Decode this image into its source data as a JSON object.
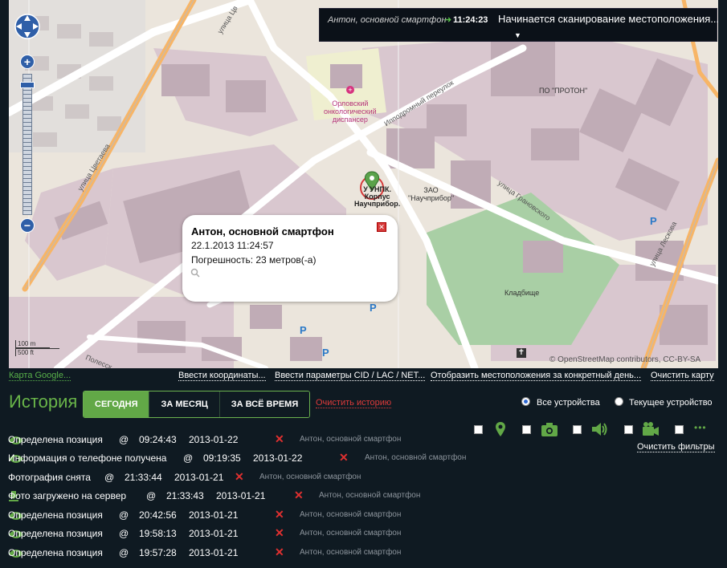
{
  "map": {
    "streets": {
      "tsvetaeva": "улица Цветаева",
      "tsv_top": "улица Цв",
      "ippodromny": "Ипподромный переулок",
      "granovskogo": "улица Грановского",
      "leskova": "улица Лескова",
      "polesskaya": "Полесск"
    },
    "pois": {
      "oncology": [
        "Орловский",
        "онкологический",
        "диспансер"
      ],
      "proton": "ПО \"ПРОТОН\"",
      "nauchpribor": [
        "ЗАО",
        "\"Научприбор\""
      ],
      "cemetery": "Кладбище"
    },
    "parking_symbol": "P",
    "scale": {
      "top": "100 m",
      "bottom": "500 ft"
    },
    "attribution": "© OpenStreetMap contributors, CC-BY-SA",
    "marker_label": [
      "У УНПК.",
      "Корпус",
      "Научприбор."
    ],
    "zoom": {
      "in": "+",
      "out": "−"
    }
  },
  "notification": {
    "device": "Антон, основной смартфон",
    "arrow": "➜",
    "time": "11:24:23",
    "message": "Начинается сканирование местоположения...",
    "expand": "▼"
  },
  "popup": {
    "title": "Антон, основной смартфон",
    "datetime": "22.1.2013 11:24:57",
    "accuracy": "Погрешность: 23 метров(-а)",
    "close": "✕"
  },
  "toolbar": {
    "google": "Карта Google...",
    "enter_coords": "Ввести координаты...",
    "enter_cid": "Ввести параметры CID / LAC / NET...",
    "show_day": "Отобразить местоположения за конкретный день...",
    "clear_map": "Очистить карту"
  },
  "history": {
    "title": "История",
    "tabs": [
      "СЕГОДНЯ",
      "ЗА МЕСЯЦ",
      "ЗА ВСЁ ВРЕМЯ"
    ],
    "active_tab": 0,
    "clear": "Очистить историю",
    "radio_all": "Все устройства",
    "radio_current": "Текущее устройство",
    "clear_filters": "Очистить фильтры",
    "filter_icons": [
      "location-pin-icon",
      "camera-icon",
      "speaker-icon",
      "video-camera-icon",
      "more-icon"
    ],
    "more_glyph": "•••",
    "at": "@",
    "rows": [
      {
        "event": "Определена позиция",
        "time": "09:24:43",
        "date": "2013-01-22",
        "action_icon": "eye-icon",
        "device": "Антон, основной смартфон"
      },
      {
        "event": "Информация о телефоне получена",
        "time": "09:19:35",
        "date": "2013-01-22",
        "action_icon": "eye-icon",
        "device": "Антон, основной смартфон"
      },
      {
        "event": "Фотография снята",
        "time": "21:33:44",
        "date": "2013-01-21",
        "action_icon": "",
        "device": "Антон, основной смартфон"
      },
      {
        "event": "Фото загружено на сервер",
        "time": "21:33:43",
        "date": "2013-01-21",
        "action_icon": "download-icon",
        "device": "Антон, основной смартфон"
      },
      {
        "event": "Определена позиция",
        "time": "20:42:56",
        "date": "2013-01-21",
        "action_icon": "eye-icon",
        "device": "Антон, основной смартфон"
      },
      {
        "event": "Определена позиция",
        "time": "19:58:13",
        "date": "2013-01-21",
        "action_icon": "eye-icon",
        "device": "Антон, основной смартфон"
      },
      {
        "event": "Определена позиция",
        "time": "19:57:28",
        "date": "2013-01-21",
        "action_icon": "eye-icon",
        "device": "Антон, основной смартфон"
      }
    ],
    "delete_glyph": "✕"
  },
  "colors": {
    "accent_green": "#62a847",
    "title_green": "#69b549",
    "danger_red": "#e03a3a",
    "background": "#0f1a22",
    "cemetery": "#a9cfa5"
  }
}
